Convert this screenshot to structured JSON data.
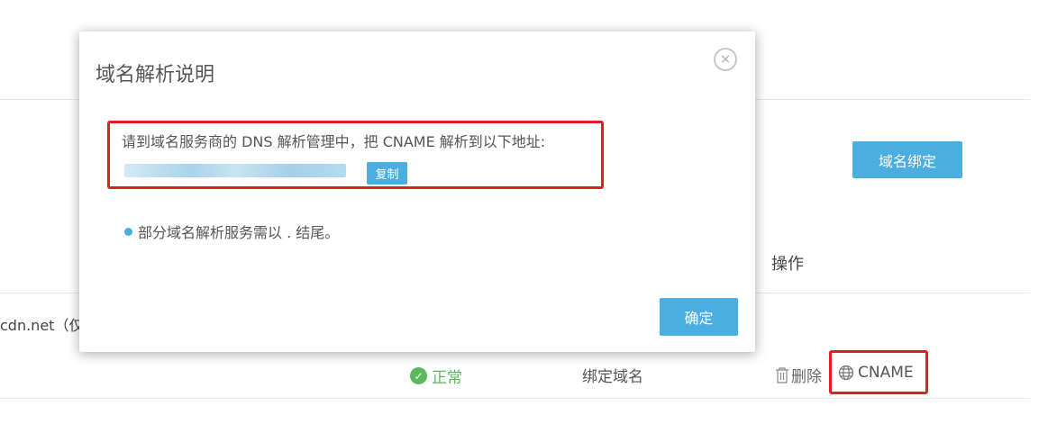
{
  "background": {
    "bind_domain_button": "域名绑定",
    "operations_header": "操作",
    "row_domain_text": "cdn.net（仅",
    "status_icon": "check-circle-icon",
    "status": "正常",
    "bound_domain": "绑定域名",
    "delete_icon": "trash-icon",
    "delete_label": "删除",
    "cname_icon": "globe-icon",
    "cname_label": "CNAME"
  },
  "modal": {
    "title": "域名解析说明",
    "close_icon": "close-circle-icon",
    "instruction": "请到域名服务商的 DNS 解析管理中，把 CNAME 解析到以下地址:",
    "copy_button": "复制",
    "note": "部分域名解析服务需以 . 结尾。",
    "confirm_button": "确定"
  },
  "colors": {
    "accent": "#4aaee0",
    "success": "#5cb85c",
    "highlight": "#e02020"
  }
}
